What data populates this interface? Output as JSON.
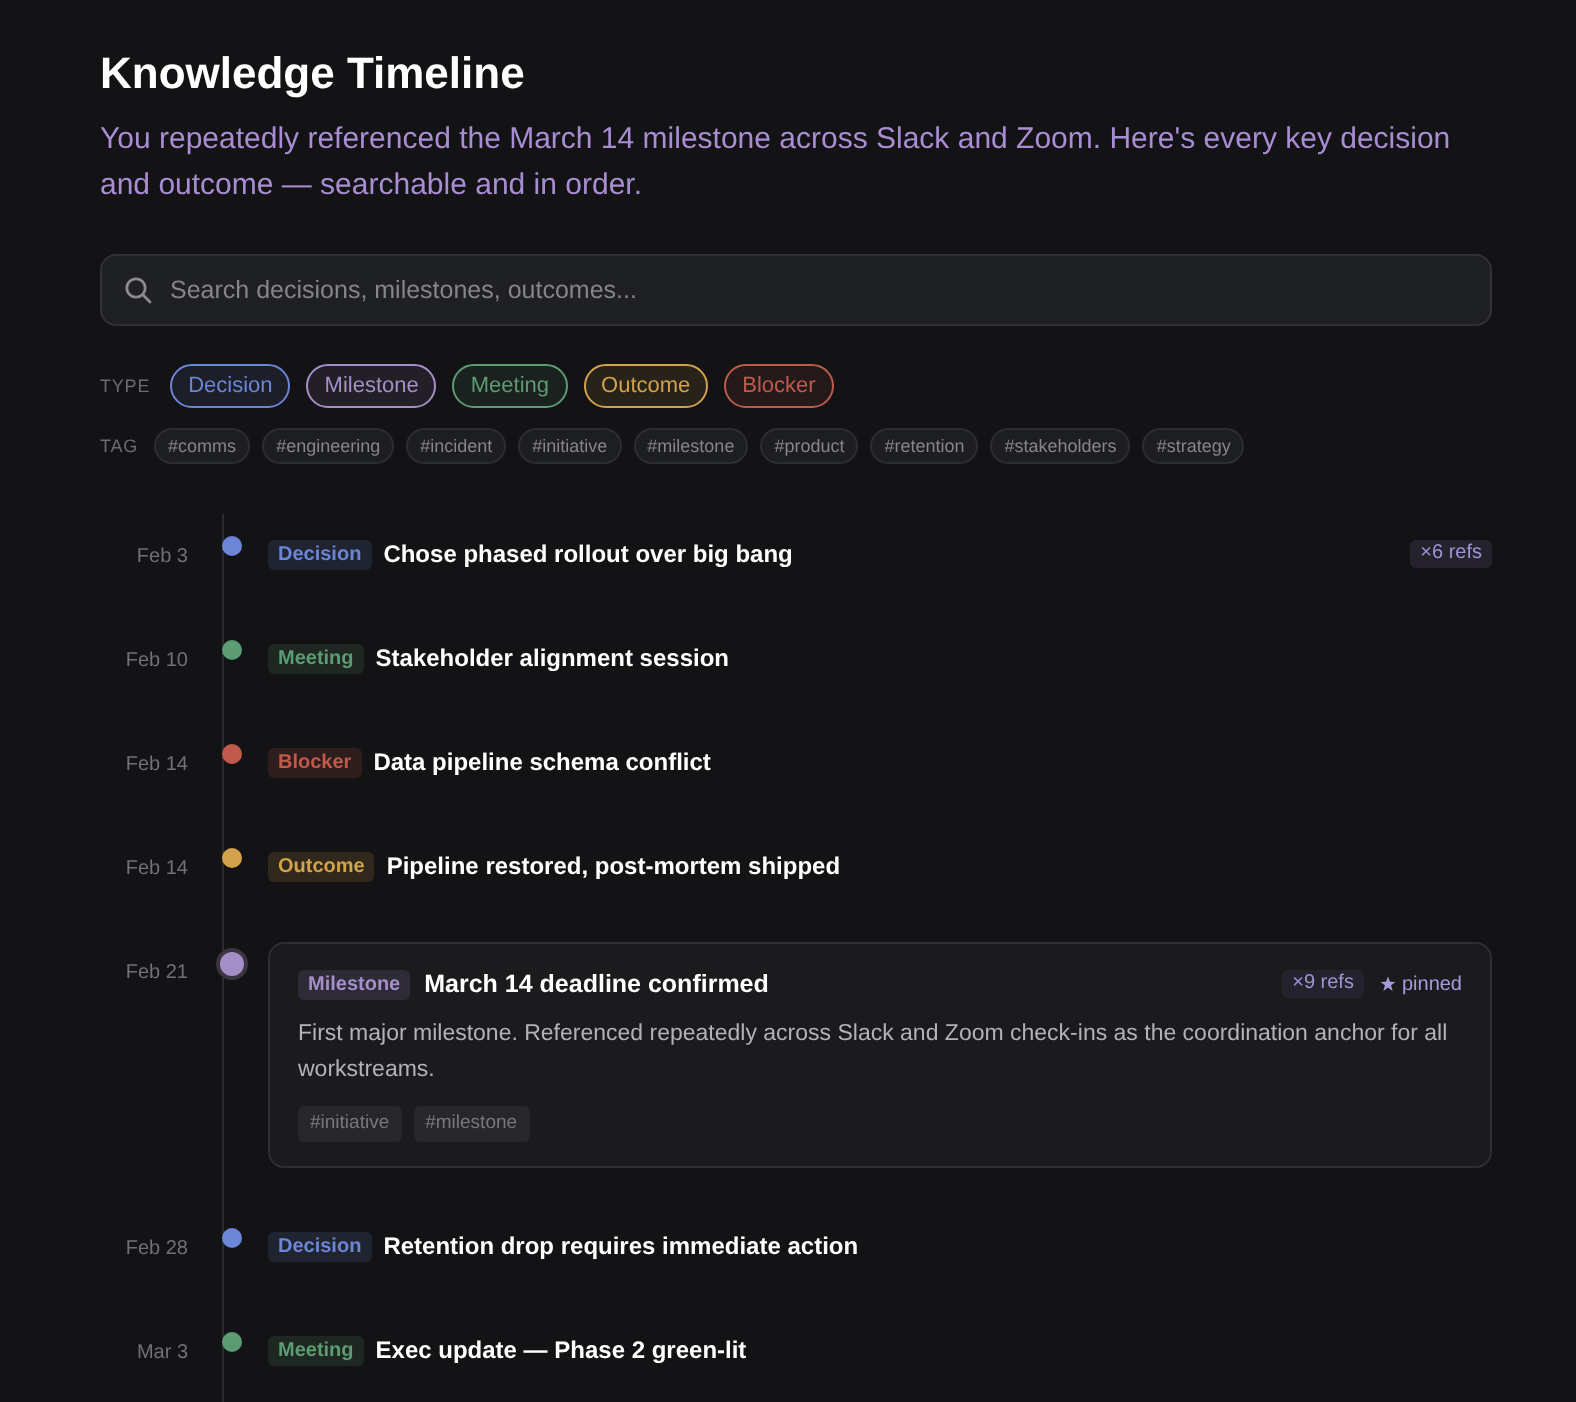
{
  "header": {
    "title": "Knowledge Timeline",
    "subtitle": "You repeatedly referenced the March 14 milestone across Slack and Zoom. Here's every key decision and outcome — searchable and in order."
  },
  "search": {
    "placeholder": "Search decisions, milestones, outcomes..."
  },
  "filters": {
    "type_label": "TYPE",
    "types": [
      {
        "label": "Decision",
        "color": "#6b86d6"
      },
      {
        "label": "Milestone",
        "color": "#a48fc8"
      },
      {
        "label": "Meeting",
        "color": "#5c9c72"
      },
      {
        "label": "Outcome",
        "color": "#d4a24a"
      },
      {
        "label": "Blocker",
        "color": "#c0594a"
      }
    ],
    "tag_label": "TAG",
    "tags": [
      "#comms",
      "#engineering",
      "#incident",
      "#initiative",
      "#milestone",
      "#product",
      "#retention",
      "#stakeholders",
      "#strategy"
    ]
  },
  "events": [
    {
      "date": "Feb 3",
      "type": "Decision",
      "color": "#6b86d6",
      "title": "Chose phased rollout over big bang",
      "refs": "×6 refs",
      "expanded": false
    },
    {
      "date": "Feb 10",
      "type": "Meeting",
      "color": "#5c9c72",
      "title": "Stakeholder alignment session",
      "expanded": false
    },
    {
      "date": "Feb 14",
      "type": "Blocker",
      "color": "#c0594a",
      "title": "Data pipeline schema conflict",
      "expanded": false
    },
    {
      "date": "Feb 14",
      "type": "Outcome",
      "color": "#d4a24a",
      "title": "Pipeline restored, post-mortem shipped",
      "expanded": false
    },
    {
      "date": "Feb 21",
      "type": "Milestone",
      "color": "#a48fc8",
      "title": "March 14 deadline confirmed",
      "refs": "×9 refs",
      "pin_label": "pinned",
      "expanded": true,
      "description": "First major milestone. Referenced repeatedly across Slack and Zoom check-ins as the coordination anchor for all workstreams.",
      "tags": [
        "#initiative",
        "#milestone"
      ]
    },
    {
      "date": "Feb 28",
      "type": "Decision",
      "color": "#6b86d6",
      "title": "Retention drop requires immediate action",
      "expanded": false
    },
    {
      "date": "Mar 3",
      "type": "Meeting",
      "color": "#5c9c72",
      "title": "Exec update — Phase 2 green-lit",
      "expanded": false
    }
  ]
}
